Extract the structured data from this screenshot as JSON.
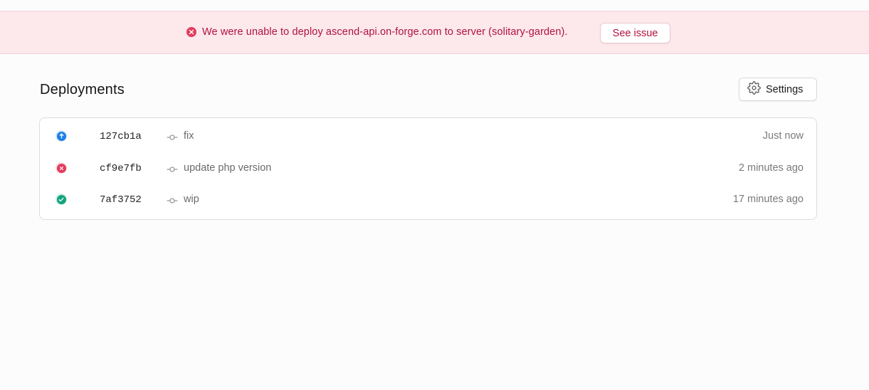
{
  "alert": {
    "icon": "x-circle-icon",
    "message": "We were unable to deploy ascend-api.on-forge.com to server (solitary-garden).",
    "button_label": "See issue",
    "color": "#b0123f",
    "background": "#fde8ec"
  },
  "header": {
    "title": "Deployments",
    "settings_label": "Settings",
    "settings_icon": "gear-icon"
  },
  "deployments": [
    {
      "status": "deploying",
      "status_icon": "arrow-up-icon",
      "status_color": "#1a7fe8",
      "hash": "127cb1a",
      "message": "fix",
      "time": "Just now"
    },
    {
      "status": "failed",
      "status_icon": "x-icon",
      "status_color": "#e23b5d",
      "hash": "cf9e7fb",
      "message": "update php version",
      "time": "2 minutes ago"
    },
    {
      "status": "success",
      "status_icon": "check-icon",
      "status_color": "#14a37f",
      "hash": "7af3752",
      "message": "wip",
      "time": "17 minutes ago"
    }
  ]
}
